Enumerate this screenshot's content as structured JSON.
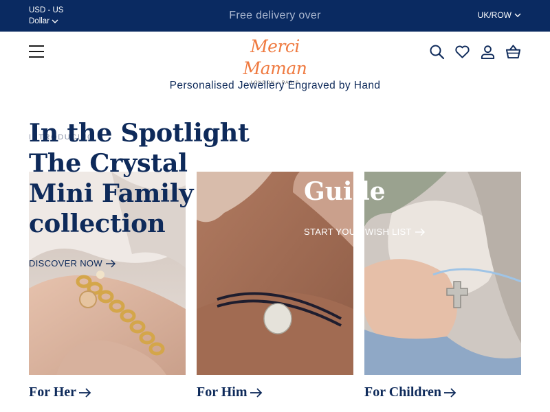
{
  "topbar": {
    "currency_code": "USD - US",
    "currency_name": "Dollar",
    "promo": "Free delivery over",
    "region": "UK/ROW"
  },
  "header": {
    "logo_script": "Merci Maman",
    "logo_sub": "LONDON • PARIS",
    "icons": [
      "menu-icon",
      "search-icon",
      "heart-icon",
      "account-icon",
      "basket-icon"
    ]
  },
  "tagline": "Personalised Jewellery Engraved by Hand",
  "hero": {
    "eyebrow": "INTRODUCING",
    "title": "In the Spotlight The Crystal Mini Family collection",
    "cta": "DISCOVER NOW"
  },
  "guide": {
    "title": "Guide",
    "cta": "START YOUR WISH LIST"
  },
  "tiles": [
    {
      "label": "For Her"
    },
    {
      "label": "For Him"
    },
    {
      "label": "For Children"
    }
  ],
  "colors": {
    "navy": "#0a2a61",
    "brand_orange": "#ef7a40",
    "text_navy": "#0e2a5a"
  }
}
